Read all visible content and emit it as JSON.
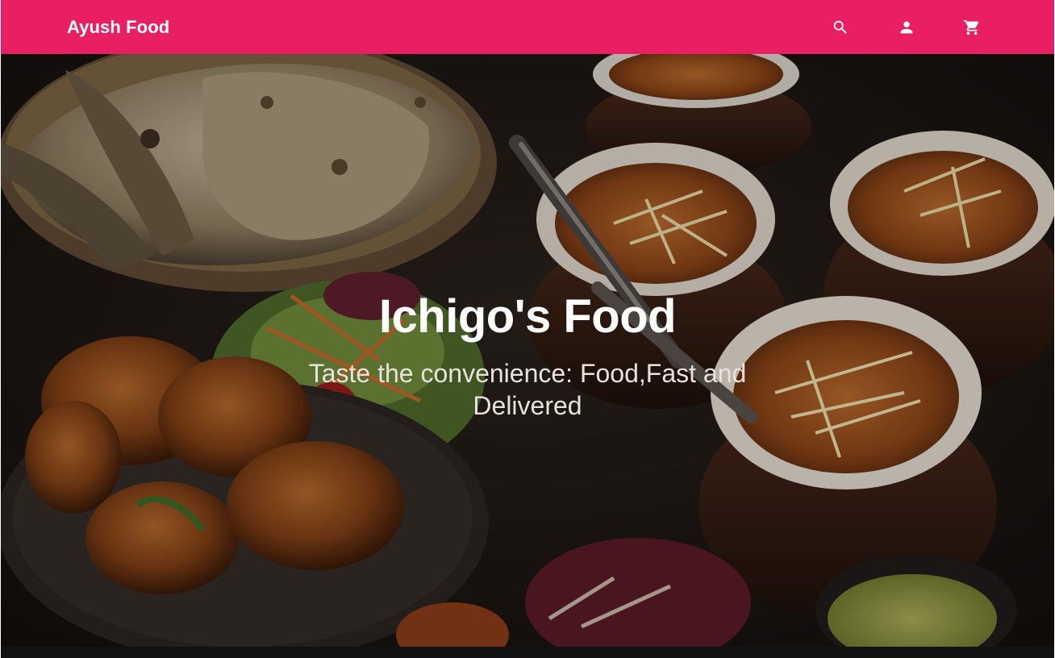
{
  "header": {
    "brand": "Ayush Food",
    "icons": [
      "search-icon",
      "account-icon",
      "cart-icon"
    ],
    "color": "#e91e63"
  },
  "hero": {
    "title": "Ichigo's Food",
    "subtitle": "Taste the convenience: Food,Fast and Delivered"
  }
}
